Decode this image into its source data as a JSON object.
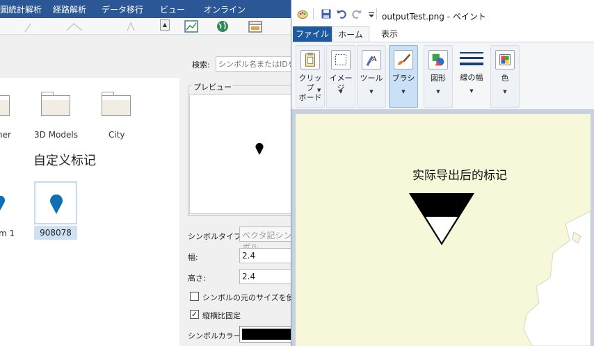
{
  "left_app": {
    "menu": [
      "圖統計解析",
      "経路解析",
      "データ移行",
      "ビュー",
      "オンライン"
    ],
    "search": {
      "label": "検索:",
      "placeholder": "シンボル名またはIDを入"
    },
    "preview": {
      "legend": "プレビュー"
    },
    "symbols_top": [
      "her",
      "3D Models",
      "City"
    ],
    "custom_section_title": "自定义标记",
    "symbols_bottom": {
      "partial_label": "m 1",
      "selected_label": "908078"
    },
    "props": {
      "symbol_type_label": "シンボルタイプ:",
      "symbol_type_value": "ベクタ記シンボル",
      "width_label": "幅:",
      "width_value": "2.4",
      "height_label": "高さ:",
      "height_value": "2.4",
      "original_size_label": "シンボルの元のサイズを使用",
      "original_size_checked": false,
      "lock_ratio_label": "縦横比固定",
      "lock_ratio_checked": true,
      "color_label": "シンボルカラー:",
      "color_value": "#000000"
    },
    "marker_color": "#0f6fb5"
  },
  "paint": {
    "title": "outputTest.png - ペイント",
    "tabs": {
      "file": "ファイル",
      "home": "ホーム",
      "view": "表示"
    },
    "groups": [
      {
        "label": "クリップ\nボード",
        "icon": "clipboard-icon"
      },
      {
        "label": "イメージ",
        "icon": "image-select-icon"
      },
      {
        "label": "ツール",
        "icon": "tools-icon"
      },
      {
        "label": "ブラシ",
        "icon": "brush-icon"
      },
      {
        "label": "図形",
        "icon": "shapes-icon"
      },
      {
        "label": "線の幅",
        "icon": "line-width-icon"
      },
      {
        "label": "色",
        "icon": "colors-icon"
      }
    ],
    "canvas_caption": "实际导出后的标记",
    "canvas_color": "#f7f7da"
  }
}
